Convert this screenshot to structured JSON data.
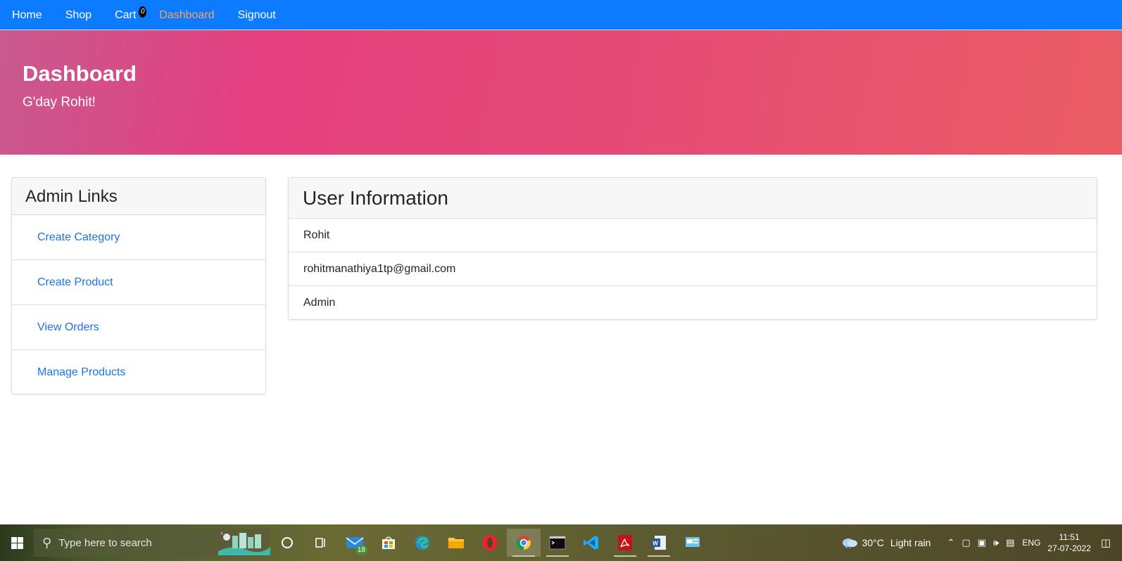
{
  "navbar": {
    "items": [
      {
        "label": "Home",
        "active": false
      },
      {
        "label": "Shop",
        "active": false
      },
      {
        "label": "Cart",
        "active": false
      },
      {
        "label": "Dashboard",
        "active": true
      },
      {
        "label": "Signout",
        "active": false
      }
    ],
    "cart_count": "0",
    "colors": {
      "background": "#0d7bff",
      "active": "#ff9f50"
    }
  },
  "hero": {
    "title": "Dashboard",
    "subtitle": "G'day Rohit!"
  },
  "admin": {
    "title": "Admin Links",
    "links": [
      {
        "label": "Create Category"
      },
      {
        "label": "Create Product"
      },
      {
        "label": "View Orders"
      },
      {
        "label": "Manage Products"
      }
    ]
  },
  "user": {
    "title": "User Information",
    "name": "Rohit",
    "email": "rohitmanathiya1tp@gmail.com",
    "role": "Admin"
  },
  "taskbar": {
    "search_placeholder": "Type here to search",
    "mail_badge": "18",
    "apps": [
      "cortana-icon",
      "task-view-icon",
      "mail-icon",
      "store-icon",
      "edge-icon",
      "file-explorer-icon",
      "opera-icon",
      "chrome-icon",
      "terminal-icon",
      "vscode-icon",
      "acrobat-icon",
      "word-icon",
      "control-panel-icon"
    ],
    "weather": {
      "temp": "30°C",
      "condition": "Light rain"
    },
    "language": "ENG",
    "time": "11:51",
    "date": "27-07-2022"
  }
}
